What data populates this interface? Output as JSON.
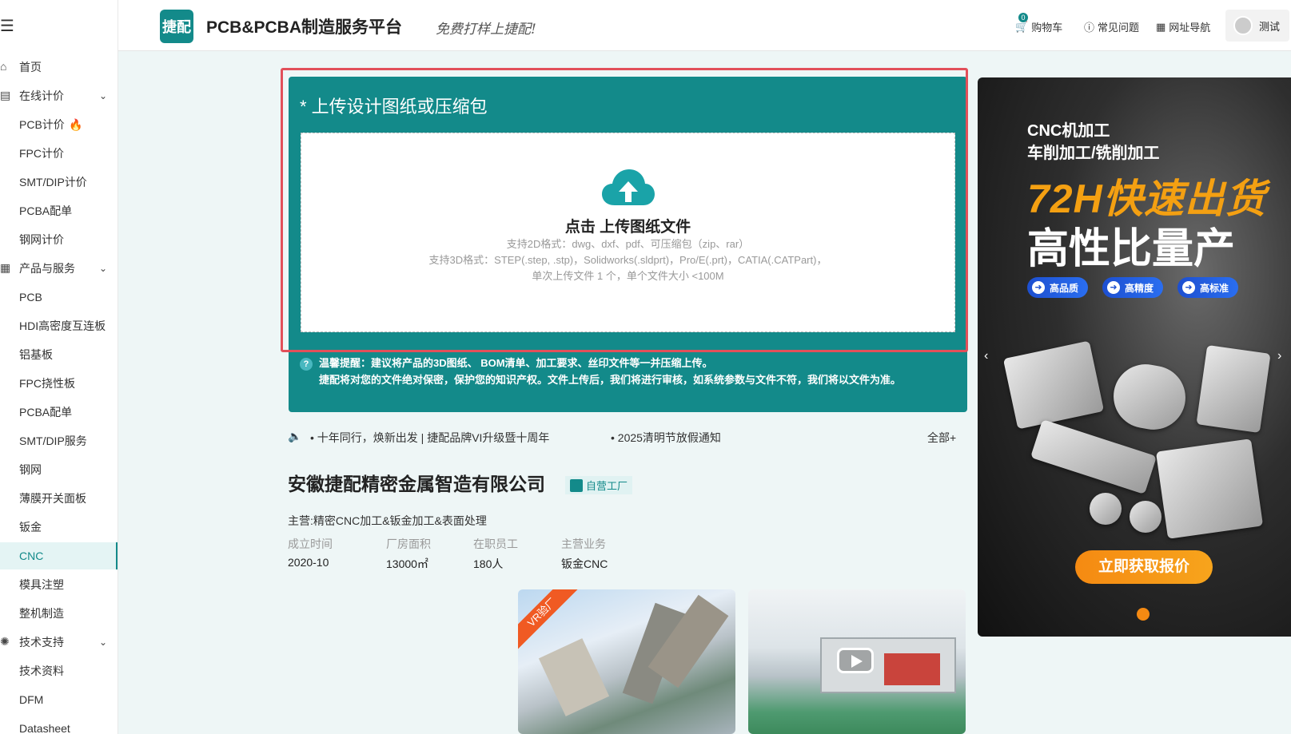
{
  "sidebar": {
    "items": [
      {
        "label": "首页",
        "icon": "home-icon"
      },
      {
        "label": "在线计价",
        "icon": "calculator-icon",
        "expandable": true
      },
      {
        "label": "PCB计价",
        "hot": true
      },
      {
        "label": "FPC计价"
      },
      {
        "label": "SMT/DIP计价"
      },
      {
        "label": "PCBA配单"
      },
      {
        "label": "钢网计价"
      },
      {
        "label": "产品与服务",
        "icon": "grid-icon",
        "expandable": true
      },
      {
        "label": "PCB"
      },
      {
        "label": "HDI高密度互连板"
      },
      {
        "label": "铝基板"
      },
      {
        "label": "FPC挠性板"
      },
      {
        "label": "PCBA配单"
      },
      {
        "label": "SMT/DIP服务"
      },
      {
        "label": "钢网"
      },
      {
        "label": "薄膜开关面板"
      },
      {
        "label": "钣金"
      },
      {
        "label": "CNC",
        "active": true
      },
      {
        "label": "模具注塑"
      },
      {
        "label": "整机制造"
      },
      {
        "label": "技术支持",
        "icon": "atom-icon",
        "expandable": true
      },
      {
        "label": "技术资料"
      },
      {
        "label": "DFM"
      },
      {
        "label": "Datasheet"
      }
    ]
  },
  "header": {
    "logo_text": "捷配",
    "brand": "PCB&PCBA制造服务平台",
    "slogan": "免费打样上捷配!",
    "cart_count": "0",
    "cart_label": "购物车",
    "faq_label": "常见问题",
    "nav_label": "网址导航",
    "user_name": "测试"
  },
  "upload": {
    "title": "* 上传设计图纸或压缩包",
    "action": "点击 上传图纸文件",
    "line1": "支持2D格式：dwg、dxf、pdf、可压缩包（zip、rar）",
    "line2": "支持3D格式：STEP(.step, .stp)，Solidworks(.sldprt)，Pro/E(.prt)，CATIA(.CATPart)，",
    "line3": "单次上传文件 1 个，单个文件大小 <100M",
    "tip1": "温馨提醒：建议将产品的3D图纸、 BOM清单、加工要求、丝印文件等一并压缩上传。",
    "tip2": "捷配将对您的文件绝对保密，保护您的知识产权。文件上传后，我们将进行审核，如系统参数与文件不符，我们将以文件为准。"
  },
  "notices": {
    "item1": "• 十年同行，焕新出发 | 捷配品牌VI升级暨十周年",
    "item2": "• 2025清明节放假通知",
    "all": "全部+"
  },
  "company": {
    "name": "安徽捷配精密金属智造有限公司",
    "badge": "自营工厂",
    "main_business": "主营:精密CNC加工&钣金加工&表面处理",
    "stats": [
      {
        "label": "成立时间",
        "value": "2020-10"
      },
      {
        "label": "厂房面积",
        "value": "13000㎡"
      },
      {
        "label": "在职员工",
        "value": "180人"
      },
      {
        "label": "主营业务",
        "value": "钣金CNC"
      }
    ],
    "vr_label": "VR验厂"
  },
  "banner": {
    "line1": "CNC机加工",
    "line2": "车削加工/铣削加工",
    "headline1": "72H快速出货",
    "headline2": "高性比量产",
    "pills": [
      "高品质",
      "高精度",
      "高标准"
    ],
    "cta": "立即获取报价",
    "accent": "#f58a12"
  },
  "colors": {
    "primary": "#138a8a",
    "highlight": "#e2505a"
  }
}
